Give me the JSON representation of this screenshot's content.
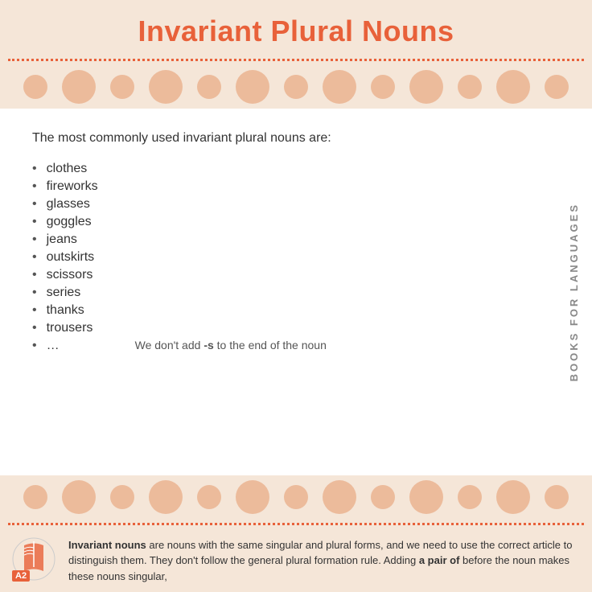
{
  "header": {
    "title": "Invariant Plural Nouns"
  },
  "intro": {
    "text": "The most commonly used invariant plural nouns are:"
  },
  "nouns": [
    {
      "word": "clothes"
    },
    {
      "word": "fireworks"
    },
    {
      "word": "glasses"
    },
    {
      "word": "goggles"
    },
    {
      "word": "jeans"
    },
    {
      "word": "outskirts"
    },
    {
      "word": "scissors"
    },
    {
      "word": "series"
    },
    {
      "word": "thanks"
    },
    {
      "word": "trousers"
    },
    {
      "word": "…"
    }
  ],
  "note": {
    "prefix": "We don't add ",
    "bold": "-s",
    "suffix": " to the end of the noun"
  },
  "side_label": "BOOKS FOR LANGUAGES",
  "footer": {
    "bold_start": "Invariant nouns",
    "text": " are nouns with the same singular and plural forms, and we need to use the correct article to distinguish them. They don't follow the general plural formation rule. Adding ",
    "bold_pair": "a pair of",
    "text2": " before the noun makes these nouns singular,",
    "level": "A2"
  }
}
